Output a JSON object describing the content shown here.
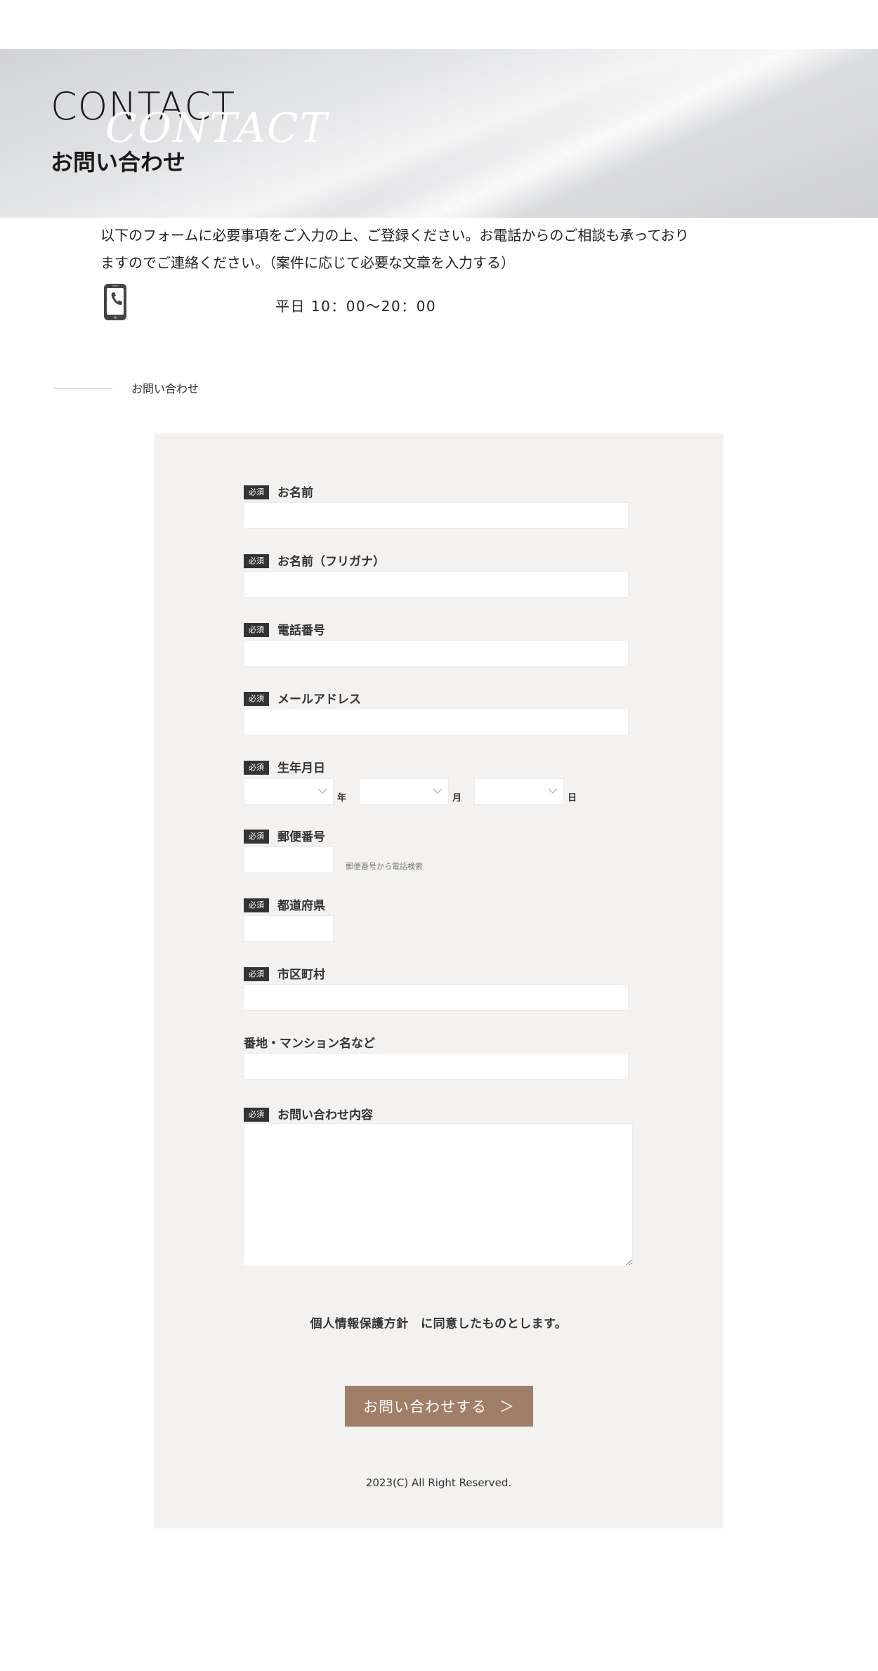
{
  "hero": {
    "title": "CONTACT",
    "title_ghost": "CONTACT",
    "subtitle": "お問い合わせ"
  },
  "intro": {
    "text": "以下のフォームに必要事項をご入力の上、ご登録ください。お電話からのご相談も承っておりますのでご連絡ください。（案件に応じて必要な文章を入力する）",
    "hours": "平日 10：00〜20：00"
  },
  "section": {
    "label": "お問い合わせ"
  },
  "form": {
    "required_badge": "必須",
    "fields": {
      "name": "お名前",
      "furigana": "お名前（フリガナ）",
      "phone": "電話番号",
      "email": "メールアドレス",
      "birthdate": "生年月日",
      "postal": "郵便番号",
      "prefecture": "都道府県",
      "city": "市区町村",
      "address": "番地・マンション名など",
      "inquiry": "お問い合わせ内容"
    },
    "units": {
      "year": "年",
      "month": "月",
      "day": "日"
    },
    "postal_hint": "郵便番号から電話検索",
    "privacy": "個人情報保護方針　に同意したものとします。",
    "submit_label": "お問い合わせする",
    "submit_arrow": "＞"
  },
  "footer": {
    "copyright": "2023(C) All Right Reserved."
  },
  "colors": {
    "accent": "#a07e67",
    "badge": "#333333",
    "panel": "#f3f2f1"
  }
}
